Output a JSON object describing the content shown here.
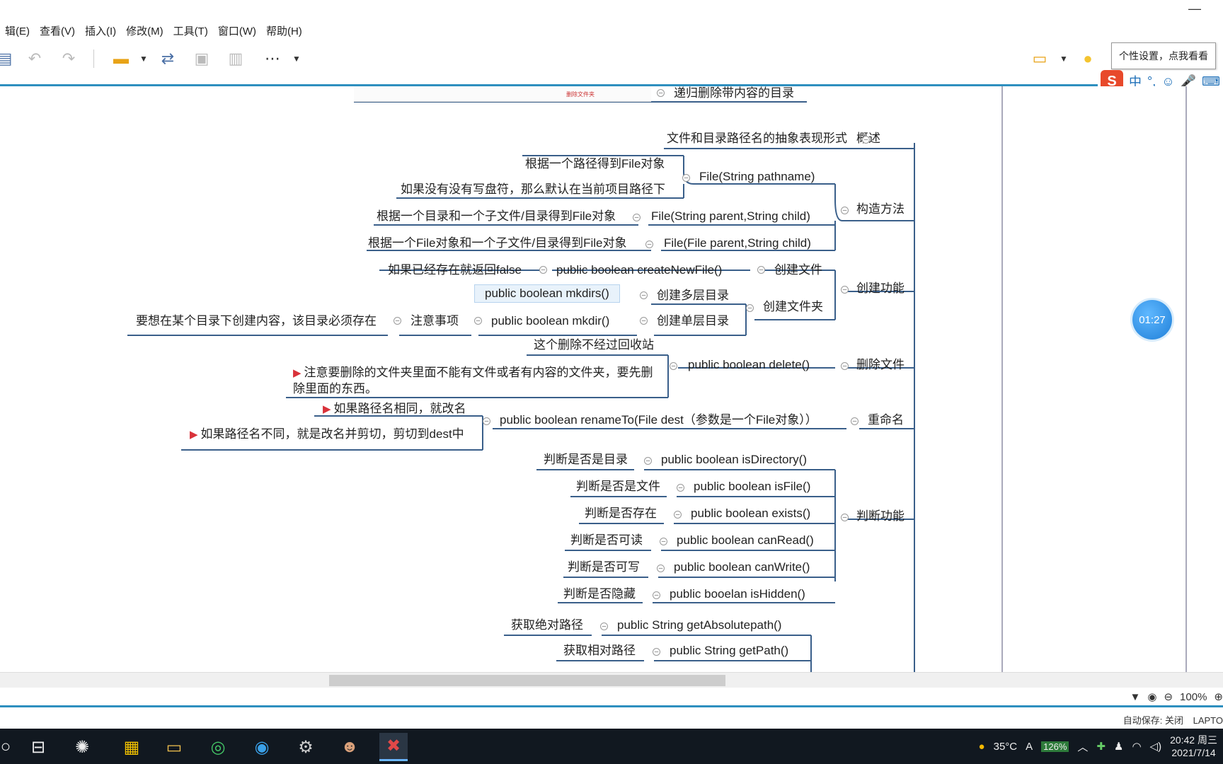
{
  "window": {
    "minimize": "—"
  },
  "menu": [
    "辑(E)",
    "查看(V)",
    "插入(I)",
    "修改(M)",
    "工具(T)",
    "窗口(W)",
    "帮助(H)"
  ],
  "toolbar": {
    "tooltip": "个性设置，点我看看"
  },
  "ime": {
    "logo": "S",
    "mode": "中",
    "punct": "°,"
  },
  "top_partial_node": "递归删除带内容的目录",
  "thumbnail_label": "删除文件夹",
  "nodes": {
    "overview": "概述",
    "overview_desc": "文件和目录路径名的抽象表现形式",
    "constructors": "构造方法",
    "ctor1": "File(String pathname)",
    "ctor1_a": "根据一个路径得到File对象",
    "ctor1_b": "如果没有没有写盘符，那么默认在当前项目路径下",
    "ctor2": "File(String parent,String child)",
    "ctor2_a": "根据一个目录和一个子文件/目录得到File对象",
    "ctor3": "File(File parent,String child)",
    "ctor3_a": "根据一个File对象和一个子文件/目录得到File对象",
    "create": "创建功能",
    "create_file": "创建文件",
    "create_newfile": "public boolean createNewFile()",
    "create_newfile_a": "如果已经存在就返回false",
    "create_dir": "创建文件夹",
    "create_multi": "创建多层目录",
    "mkdirs": "public boolean mkdirs()",
    "create_single": "创建单层目录",
    "mkdir": "public boolean mkdir()",
    "notice": "注意事项",
    "notice_a": "要想在某个目录下创建内容，该目录必须存在",
    "delete": "删除文件",
    "delete_m": "public boolean delete()",
    "delete_a": "这个删除不经过回收站",
    "delete_b": "注意要删除的文件夹里面不能有文件或者有内容的文件夹，要先删除里面的东西。",
    "rename": "重命名",
    "rename_m": "public boolean renameTo(File dest（参数是一个File对象））",
    "rename_a": "如果路径名相同，就改名",
    "rename_b": "如果路径名不同，就是改名并剪切，剪切到dest中",
    "judge": "判断功能",
    "isdir": "public boolean isDirectory()",
    "isdir_a": "判断是否是目录",
    "isfile": "public boolean isFile()",
    "isfile_a": "判断是否是文件",
    "exists": "public boolean exists()",
    "exists_a": "判断是否存在",
    "canread": "public boolean canRead()",
    "canread_a": "判断是否可读",
    "canwrite": "public boolean canWrite()",
    "canwrite_a": "判断是否可写",
    "ishidden": "public booelan isHidden()",
    "ishidden_a": "判断是否隐藏",
    "abspath": "public String getAbsolutepath()",
    "abspath_a": "获取绝对路径",
    "getpath": "public String getPath()",
    "getpath_a": "获取相对路径"
  },
  "timer": "01:27",
  "status": {
    "zoom": "100%",
    "autosave": "自动保存: 关闭",
    "device": "LAPTO"
  },
  "taskbar": {
    "time": "20:42 周三",
    "date": "2021/7/14",
    "temp": "35°C",
    "lang": "A",
    "battery": "126%"
  },
  "colors": {
    "accent": "#2e8fbf",
    "flag": "#d9323a",
    "taskbar": "#111820"
  }
}
